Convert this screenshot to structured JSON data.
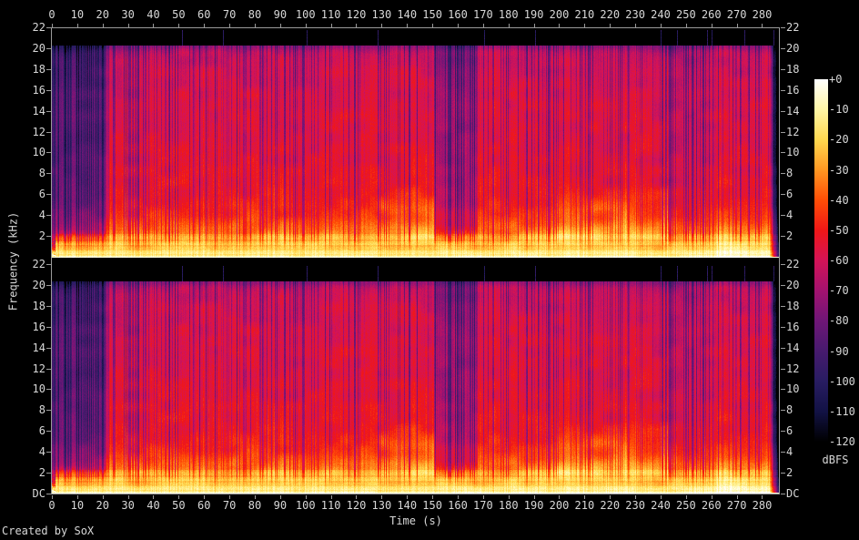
{
  "figure": {
    "credit": "Created by SoX",
    "background": "#000000",
    "text_color": "#d8d8d8",
    "axis_color": "#9a9a9a"
  },
  "chart_data": {
    "type": "heatmap",
    "subtype": "audio-spectrogram",
    "tool": "SoX spectrogram",
    "channels": 2,
    "title": "",
    "xlabel": "Time (s)",
    "ylabel": "Frequency (kHz)",
    "x_range_s": [
      0,
      287
    ],
    "x_ticks": [
      0,
      10,
      20,
      30,
      40,
      50,
      60,
      70,
      80,
      90,
      100,
      110,
      120,
      130,
      140,
      150,
      160,
      170,
      180,
      190,
      200,
      210,
      220,
      230,
      240,
      250,
      260,
      270,
      280
    ],
    "y_range_khz": [
      0,
      22
    ],
    "y_tick_labels": [
      "22",
      "20",
      "18",
      "16",
      "14",
      "12",
      "10",
      "8",
      "6",
      "4",
      "2",
      "DC"
    ],
    "y_tick_khz": [
      22,
      20,
      18,
      16,
      14,
      12,
      10,
      8,
      6,
      4,
      2,
      0
    ],
    "cutoff_khz": 20.35,
    "colorbar": {
      "label": "dBFS",
      "tick_labels": [
        "+0",
        "-10",
        "-20",
        "-30",
        "-40",
        "-50",
        "-60",
        "-70",
        "-80",
        "-90",
        "-100",
        "-110",
        "-120"
      ],
      "range_db": [
        0,
        -120
      ]
    },
    "palette_stops": [
      {
        "db": 0,
        "color": "#ffffff"
      },
      {
        "db": -10,
        "color": "#fff6a6"
      },
      {
        "db": -20,
        "color": "#ffd84f"
      },
      {
        "db": -30,
        "color": "#ff9722"
      },
      {
        "db": -40,
        "color": "#ff4e06"
      },
      {
        "db": -50,
        "color": "#f01717"
      },
      {
        "db": -60,
        "color": "#d41357"
      },
      {
        "db": -70,
        "color": "#a3126f"
      },
      {
        "db": -80,
        "color": "#6f1677"
      },
      {
        "db": -90,
        "color": "#471a6e"
      },
      {
        "db": -100,
        "color": "#281c62"
      },
      {
        "db": -110,
        "color": "#121245"
      },
      {
        "db": -120,
        "color": "#000000"
      }
    ],
    "level_profile_db_vs_khz": [
      [
        0,
        -4
      ],
      [
        0.3,
        -14
      ],
      [
        1,
        -22
      ],
      [
        2,
        -30
      ],
      [
        3,
        -40
      ],
      [
        4,
        -46
      ],
      [
        6,
        -52
      ],
      [
        9,
        -55
      ],
      [
        14,
        -57
      ],
      [
        18,
        -60
      ],
      [
        19.8,
        -63
      ],
      [
        20.3,
        -68
      ]
    ],
    "sections": [
      {
        "t0": 0,
        "t1": 1.5,
        "kind": "lead-in"
      },
      {
        "t0": 1.5,
        "t1": 21,
        "kind": "intro-quiet-high"
      },
      {
        "t0": 21,
        "t1": 129,
        "kind": "main"
      },
      {
        "t0": 129,
        "t1": 151,
        "kind": "loud-chorus"
      },
      {
        "t0": 151,
        "t1": 168,
        "kind": "quiet-verse"
      },
      {
        "t0": 168,
        "t1": 199,
        "kind": "main"
      },
      {
        "t0": 199,
        "t1": 243,
        "kind": "loud-chorus"
      },
      {
        "t0": 243,
        "t1": 262,
        "kind": "main-soft"
      },
      {
        "t0": 262,
        "t1": 283,
        "kind": "outro-bass-heavy"
      },
      {
        "t0": 283,
        "t1": 287,
        "kind": "fade-out"
      }
    ]
  }
}
